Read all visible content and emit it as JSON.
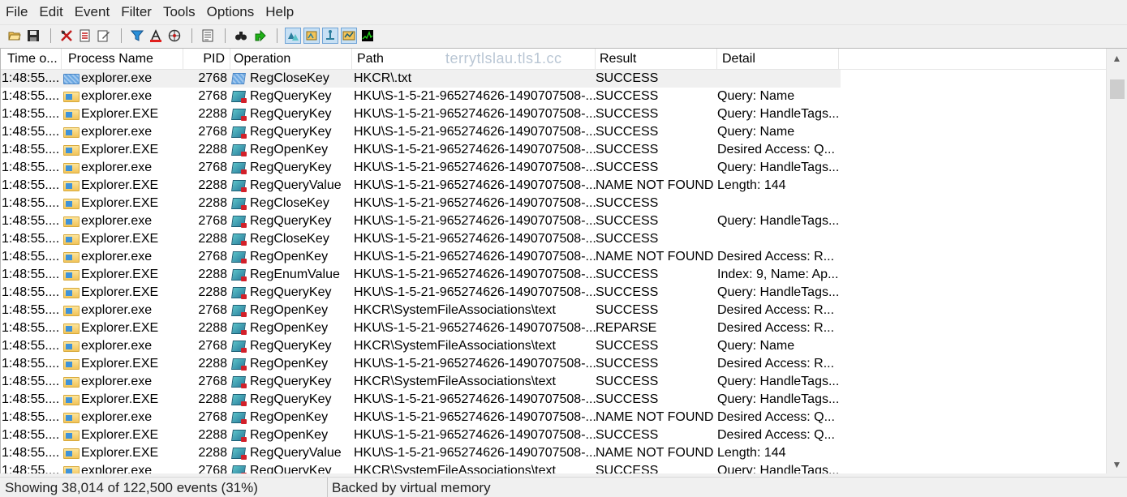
{
  "menu": [
    "File",
    "Edit",
    "Event",
    "Filter",
    "Tools",
    "Options",
    "Help"
  ],
  "toolbar": {
    "buttons": [
      {
        "name": "open-icon",
        "glyph": "📂"
      },
      {
        "name": "save-icon",
        "glyph": "💾"
      },
      {
        "name": "capture-icon",
        "glyph": "✂"
      },
      {
        "name": "autoscroll-icon",
        "glyph": "▤"
      },
      {
        "name": "clear-icon",
        "glyph": "✎"
      },
      {
        "name": "filter-icon",
        "glyph": "▽"
      },
      {
        "name": "highlight-icon",
        "glyph": "A"
      },
      {
        "name": "network-icon",
        "glyph": "◎"
      },
      {
        "name": "process-tree-icon",
        "glyph": "▦"
      },
      {
        "name": "find-icon",
        "glyph": "🔭"
      },
      {
        "name": "jump-icon",
        "glyph": "➜"
      },
      {
        "name": "registry-activity-icon",
        "glyph": "R"
      },
      {
        "name": "filesystem-activity-icon",
        "glyph": "F"
      },
      {
        "name": "network-activity-icon",
        "glyph": "N"
      },
      {
        "name": "process-activity-icon",
        "glyph": "P"
      },
      {
        "name": "profiling-icon",
        "glyph": "M"
      }
    ]
  },
  "columns": {
    "time": "Time o...",
    "process": "Process Name",
    "pid": "PID",
    "operation": "Operation",
    "path": "Path",
    "result": "Result",
    "detail": "Detail"
  },
  "watermark": "terrytlslau.tls1.cc",
  "rows": [
    {
      "time": "1:48:55....",
      "process": "explorer.exe",
      "pid": "2768",
      "op": "RegCloseKey",
      "path": "HKCR\\.txt",
      "result": "SUCCESS",
      "detail": ""
    },
    {
      "time": "1:48:55....",
      "process": "explorer.exe",
      "pid": "2768",
      "op": "RegQueryKey",
      "path": "HKU\\S-1-5-21-965274626-1490707508-...",
      "result": "SUCCESS",
      "detail": "Query: Name"
    },
    {
      "time": "1:48:55....",
      "process": "Explorer.EXE",
      "pid": "2288",
      "op": "RegQueryKey",
      "path": "HKU\\S-1-5-21-965274626-1490707508-...",
      "result": "SUCCESS",
      "detail": "Query: HandleTags..."
    },
    {
      "time": "1:48:55....",
      "process": "explorer.exe",
      "pid": "2768",
      "op": "RegQueryKey",
      "path": "HKU\\S-1-5-21-965274626-1490707508-...",
      "result": "SUCCESS",
      "detail": "Query: Name"
    },
    {
      "time": "1:48:55....",
      "process": "Explorer.EXE",
      "pid": "2288",
      "op": "RegOpenKey",
      "path": "HKU\\S-1-5-21-965274626-1490707508-...",
      "result": "SUCCESS",
      "detail": "Desired Access: Q..."
    },
    {
      "time": "1:48:55....",
      "process": "explorer.exe",
      "pid": "2768",
      "op": "RegQueryKey",
      "path": "HKU\\S-1-5-21-965274626-1490707508-...",
      "result": "SUCCESS",
      "detail": "Query: HandleTags..."
    },
    {
      "time": "1:48:55....",
      "process": "Explorer.EXE",
      "pid": "2288",
      "op": "RegQueryValue",
      "path": "HKU\\S-1-5-21-965274626-1490707508-...",
      "result": "NAME NOT FOUND",
      "detail": "Length: 144"
    },
    {
      "time": "1:48:55....",
      "process": "Explorer.EXE",
      "pid": "2288",
      "op": "RegCloseKey",
      "path": "HKU\\S-1-5-21-965274626-1490707508-...",
      "result": "SUCCESS",
      "detail": ""
    },
    {
      "time": "1:48:55....",
      "process": "explorer.exe",
      "pid": "2768",
      "op": "RegQueryKey",
      "path": "HKU\\S-1-5-21-965274626-1490707508-...",
      "result": "SUCCESS",
      "detail": "Query: HandleTags..."
    },
    {
      "time": "1:48:55....",
      "process": "Explorer.EXE",
      "pid": "2288",
      "op": "RegCloseKey",
      "path": "HKU\\S-1-5-21-965274626-1490707508-...",
      "result": "SUCCESS",
      "detail": ""
    },
    {
      "time": "1:48:55....",
      "process": "explorer.exe",
      "pid": "2768",
      "op": "RegOpenKey",
      "path": "HKU\\S-1-5-21-965274626-1490707508-...",
      "result": "NAME NOT FOUND",
      "detail": "Desired Access: R..."
    },
    {
      "time": "1:48:55....",
      "process": "Explorer.EXE",
      "pid": "2288",
      "op": "RegEnumValue",
      "path": "HKU\\S-1-5-21-965274626-1490707508-...",
      "result": "SUCCESS",
      "detail": "Index: 9, Name: Ap..."
    },
    {
      "time": "1:48:55....",
      "process": "Explorer.EXE",
      "pid": "2288",
      "op": "RegQueryKey",
      "path": "HKU\\S-1-5-21-965274626-1490707508-...",
      "result": "SUCCESS",
      "detail": "Query: HandleTags..."
    },
    {
      "time": "1:48:55....",
      "process": "explorer.exe",
      "pid": "2768",
      "op": "RegOpenKey",
      "path": "HKCR\\SystemFileAssociations\\text",
      "result": "SUCCESS",
      "detail": "Desired Access: R..."
    },
    {
      "time": "1:48:55....",
      "process": "Explorer.EXE",
      "pid": "2288",
      "op": "RegOpenKey",
      "path": "HKU\\S-1-5-21-965274626-1490707508-...",
      "result": "REPARSE",
      "detail": "Desired Access: R..."
    },
    {
      "time": "1:48:55....",
      "process": "explorer.exe",
      "pid": "2768",
      "op": "RegQueryKey",
      "path": "HKCR\\SystemFileAssociations\\text",
      "result": "SUCCESS",
      "detail": "Query: Name"
    },
    {
      "time": "1:48:55....",
      "process": "Explorer.EXE",
      "pid": "2288",
      "op": "RegOpenKey",
      "path": "HKU\\S-1-5-21-965274626-1490707508-...",
      "result": "SUCCESS",
      "detail": "Desired Access: R..."
    },
    {
      "time": "1:48:55....",
      "process": "explorer.exe",
      "pid": "2768",
      "op": "RegQueryKey",
      "path": "HKCR\\SystemFileAssociations\\text",
      "result": "SUCCESS",
      "detail": "Query: HandleTags..."
    },
    {
      "time": "1:48:55....",
      "process": "Explorer.EXE",
      "pid": "2288",
      "op": "RegQueryKey",
      "path": "HKU\\S-1-5-21-965274626-1490707508-...",
      "result": "SUCCESS",
      "detail": "Query: HandleTags..."
    },
    {
      "time": "1:48:55....",
      "process": "explorer.exe",
      "pid": "2768",
      "op": "RegOpenKey",
      "path": "HKU\\S-1-5-21-965274626-1490707508-...",
      "result": "NAME NOT FOUND",
      "detail": "Desired Access: Q..."
    },
    {
      "time": "1:48:55....",
      "process": "Explorer.EXE",
      "pid": "2288",
      "op": "RegOpenKey",
      "path": "HKU\\S-1-5-21-965274626-1490707508-...",
      "result": "SUCCESS",
      "detail": "Desired Access: Q..."
    },
    {
      "time": "1:48:55....",
      "process": "Explorer.EXE",
      "pid": "2288",
      "op": "RegQueryValue",
      "path": "HKU\\S-1-5-21-965274626-1490707508-...",
      "result": "NAME NOT FOUND",
      "detail": "Length: 144"
    },
    {
      "time": "1:48:55....",
      "process": "explorer.exe",
      "pid": "2768",
      "op": "RegQueryKey",
      "path": "HKCR\\SystemFileAssociations\\text",
      "result": "SUCCESS",
      "detail": "Query: HandleTags..."
    }
  ],
  "status": {
    "events": "Showing 38,014 of 122,500 events (31%)",
    "memory": "Backed by virtual memory"
  }
}
